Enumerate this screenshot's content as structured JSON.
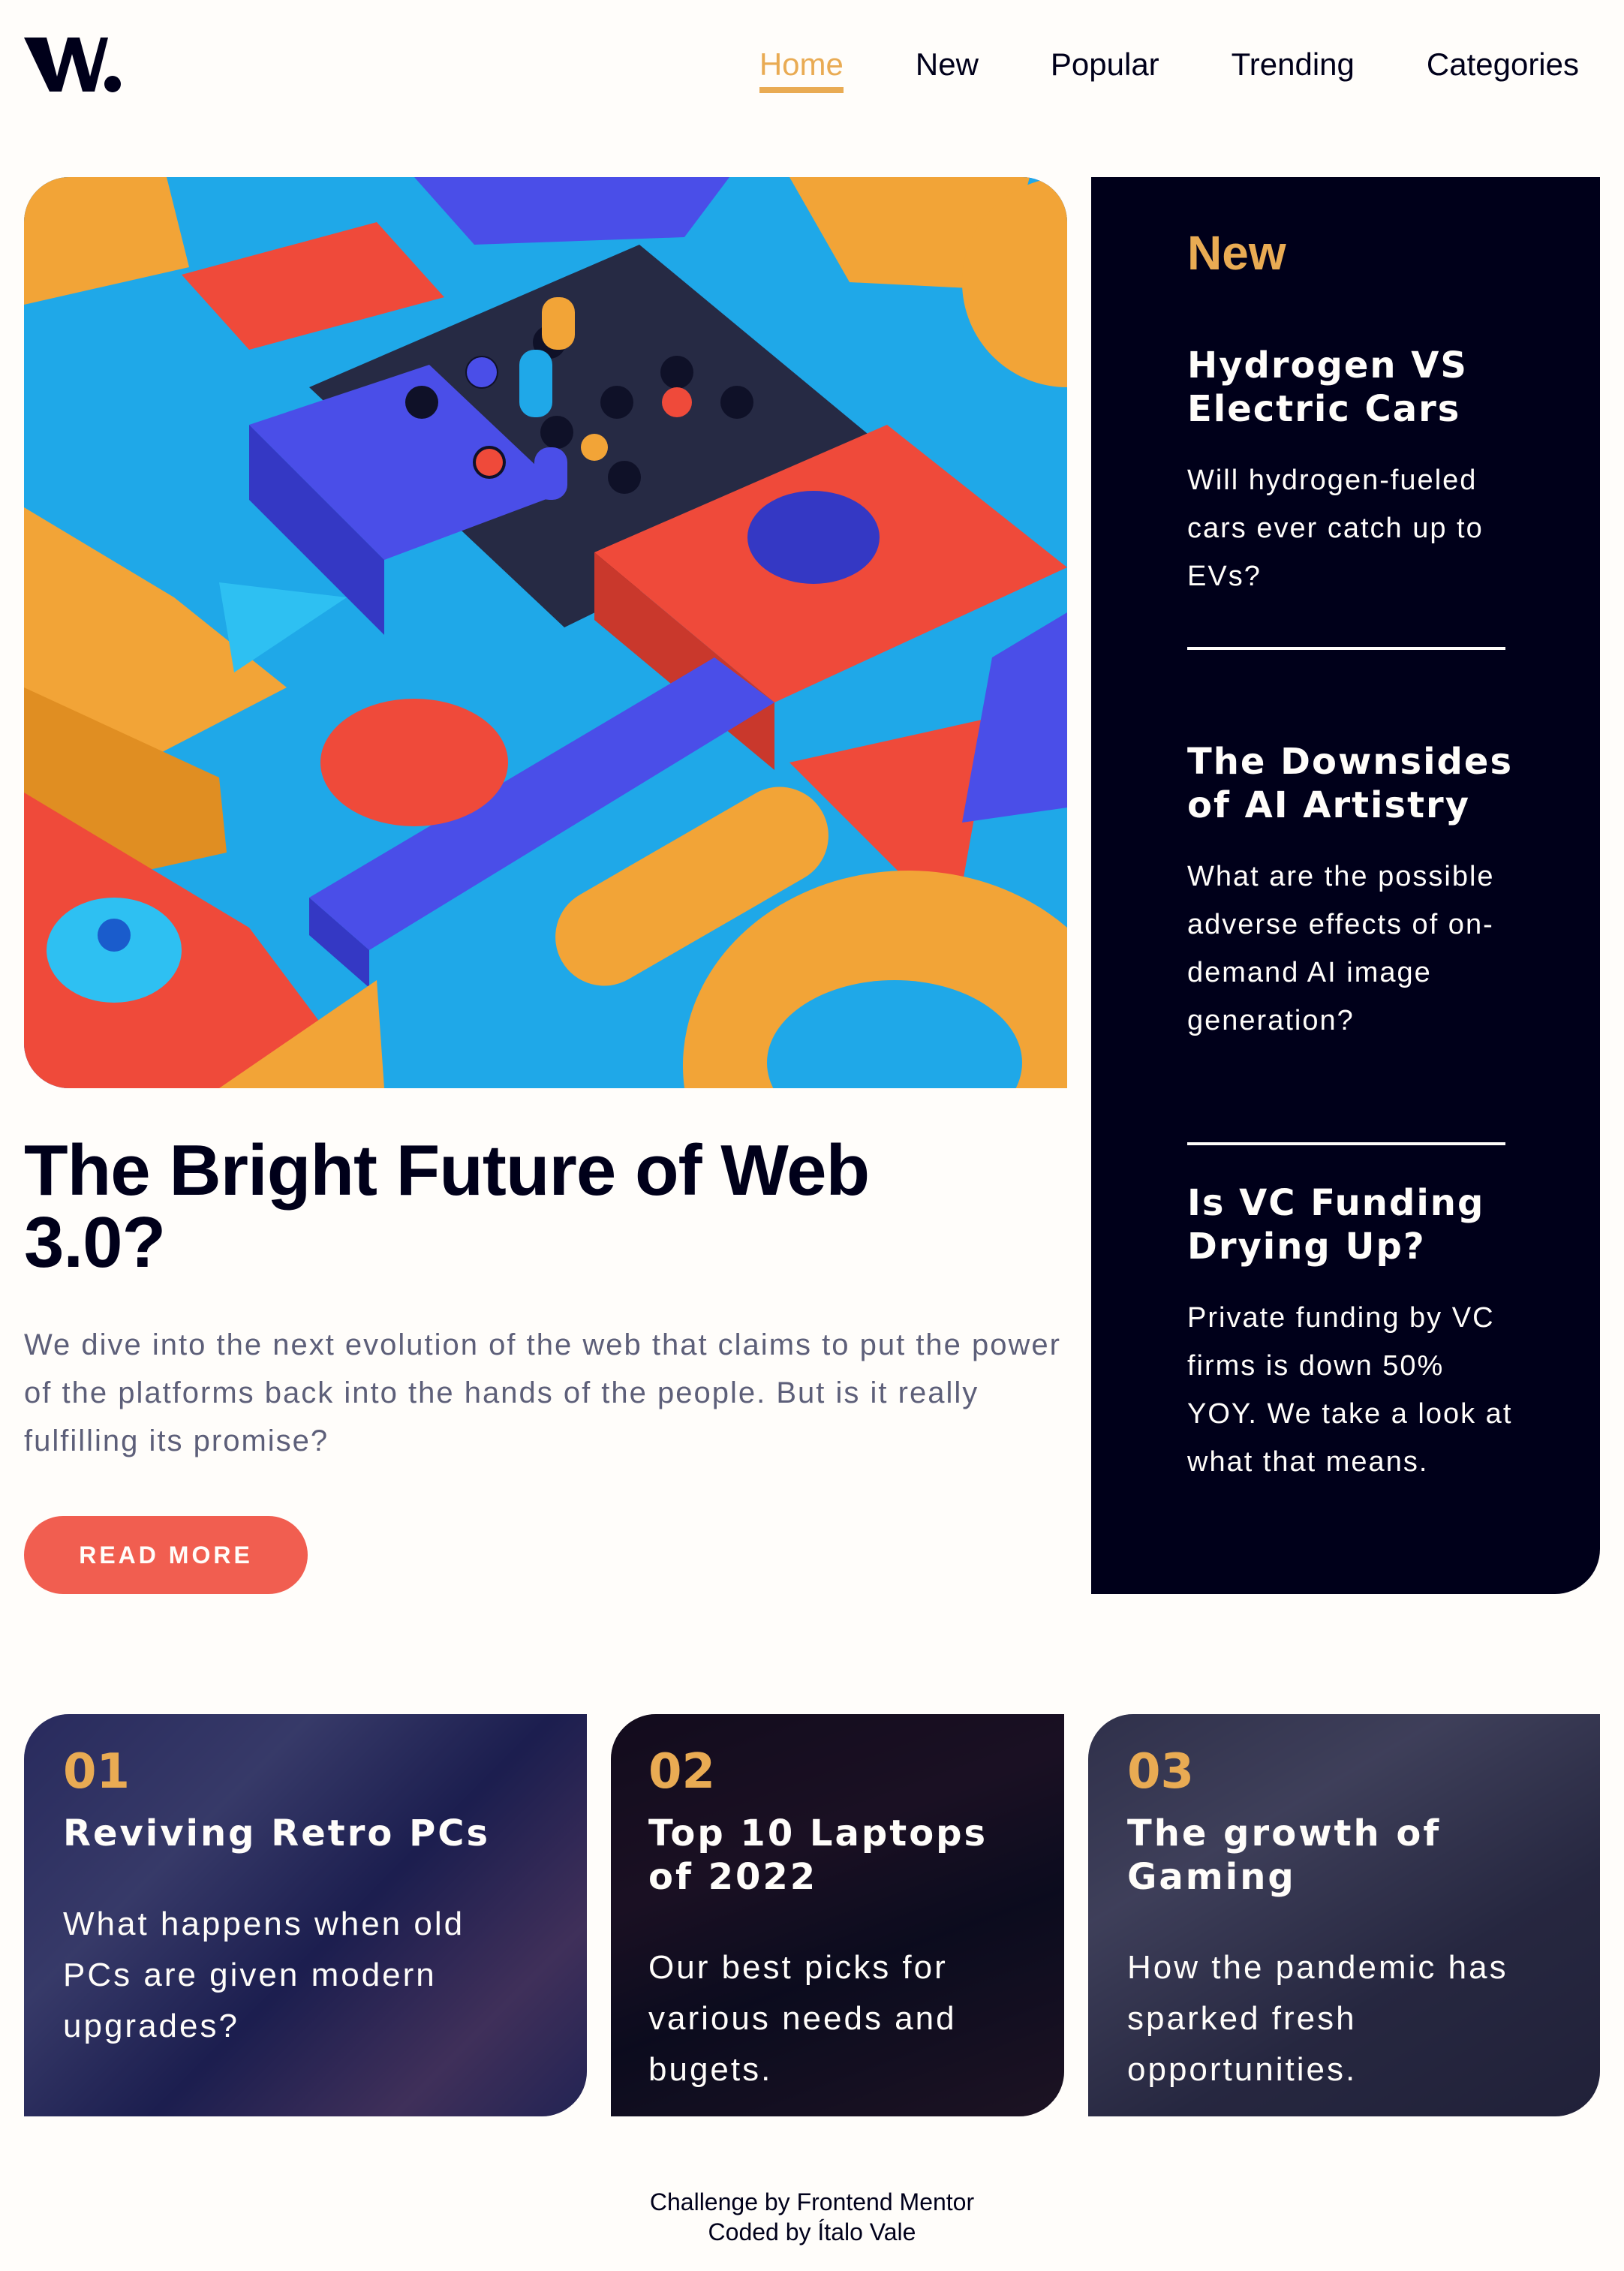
{
  "header": {
    "logo_text": "W.",
    "nav": [
      {
        "label": "Home",
        "active": true
      },
      {
        "label": "New",
        "active": false
      },
      {
        "label": "Popular",
        "active": false
      },
      {
        "label": "Trending",
        "active": false
      },
      {
        "label": "Categories",
        "active": false
      }
    ]
  },
  "hero": {
    "title": "The Bright Future of Web 3.0?",
    "description": "We dive into the next evolution of the web that claims to put the power of the platforms back into the hands of the people. But is it really fulfilling its promise?",
    "button_label": "READ MORE"
  },
  "new_panel": {
    "heading": "New",
    "items": [
      {
        "title": "Hydrogen VS Electric Cars",
        "text": "Will hydrogen-fueled cars ever catch up to EVs?"
      },
      {
        "title": "The Downsides of AI Artistry",
        "text": "What are the possible adverse effects of on-demand AI image generation?"
      },
      {
        "title": "Is VC Funding Drying Up?",
        "text": "Private funding by VC firms is down 50% YOY. We take a look at what that means."
      }
    ]
  },
  "cards": [
    {
      "number": "01",
      "title": "Reviving Retro PCs",
      "text": "What happens when old PCs are given modern upgrades?"
    },
    {
      "number": "02",
      "title": "Top 10 Laptops of 2022",
      "text": "Our best picks for various needs and bugets."
    },
    {
      "number": "03",
      "title": "The growth of Gaming",
      "text": "How the pandemic has sparked fresh opportunities."
    }
  ],
  "footer": {
    "line1": "Challenge by Frontend Mentor",
    "line2": "Coded by Ítalo Vale"
  },
  "colors": {
    "accent_orange": "#e9ab53",
    "accent_red": "#f15e50",
    "dark_navy": "#00001a",
    "off_white": "#fffdfa",
    "grey_text": "#5d5f79"
  }
}
